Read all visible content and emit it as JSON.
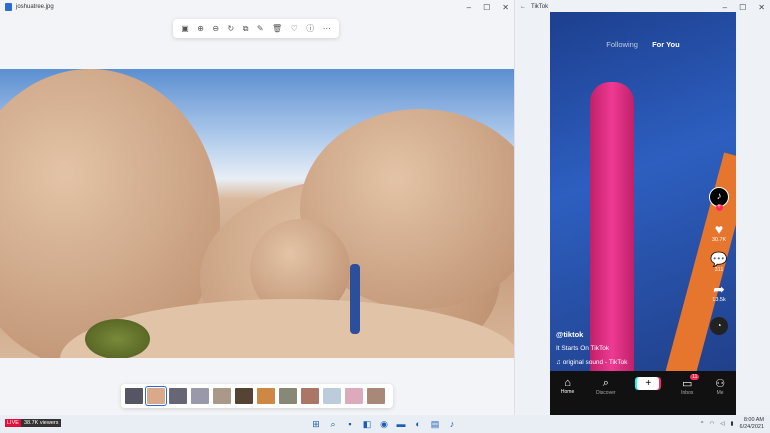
{
  "photos_window": {
    "title": "joshuatree.jpg",
    "controls": [
      "–",
      "☐",
      "✕"
    ],
    "toolbar": [
      {
        "name": "gallery-icon",
        "glyph": "▣"
      },
      {
        "name": "zoom-in-icon",
        "glyph": "⊕"
      },
      {
        "name": "zoom-out-icon",
        "glyph": "⊖"
      },
      {
        "name": "rotate-icon",
        "glyph": "↻"
      },
      {
        "name": "crop-icon",
        "glyph": "⧉"
      },
      {
        "name": "edit-icon",
        "glyph": "✎"
      },
      {
        "name": "delete-icon",
        "glyph": "🗑"
      },
      {
        "name": "favorite-icon",
        "glyph": "♡"
      },
      {
        "name": "info-icon",
        "glyph": "ⓘ"
      },
      {
        "name": "more-icon",
        "glyph": "⋯"
      }
    ],
    "filmstrip_count": 12,
    "selected_thumb": 1
  },
  "tiktok_window": {
    "title": "TikTok",
    "back": "←",
    "controls": [
      "–",
      "☐",
      "✕"
    ],
    "tabs": {
      "following": "Following",
      "for_you": "For You"
    },
    "likes": "30.7K",
    "comments": "311",
    "shares": "13.5k",
    "username": "@tiktok",
    "caption": "It Starts On TikTok",
    "sound": "original sound - TikTok",
    "nav": {
      "home": "Home",
      "discover": "Discover",
      "inbox": "Inbox",
      "inbox_badge": "11",
      "me": "Me"
    }
  },
  "taskbar": {
    "live": "LIVE",
    "viewers": "38.7K viewers",
    "time": "8:00 AM",
    "date": "6/24/2021",
    "icons": [
      {
        "name": "start-icon",
        "glyph": "⊞"
      },
      {
        "name": "search-icon",
        "glyph": "⌕"
      },
      {
        "name": "task-view-icon",
        "glyph": "▪"
      },
      {
        "name": "widgets-icon",
        "glyph": "◧"
      },
      {
        "name": "chat-icon",
        "glyph": "◉"
      },
      {
        "name": "explorer-icon",
        "glyph": "▬"
      },
      {
        "name": "edge-icon",
        "glyph": "◐"
      },
      {
        "name": "store-icon",
        "glyph": "▤"
      },
      {
        "name": "tiktok-icon",
        "glyph": "♪"
      }
    ]
  },
  "colors": {
    "accent": "#2b6cd4",
    "tiktok_red": "#fe2c55",
    "tiktok_cyan": "#25f4ee"
  }
}
